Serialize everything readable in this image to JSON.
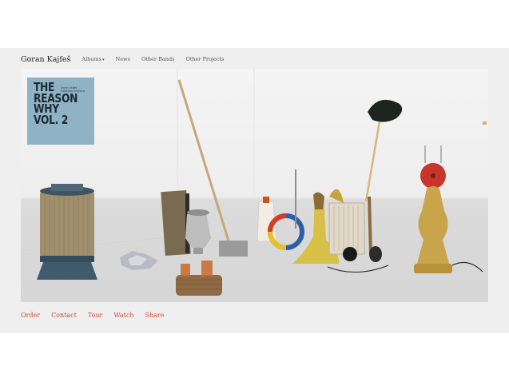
{
  "header": {
    "brand": "Goran Kajfeš",
    "nav": [
      {
        "label": "Albums",
        "dropdown": true
      },
      {
        "label": "News"
      },
      {
        "label": "Other Bands"
      },
      {
        "label": "Other Projects"
      }
    ]
  },
  "cover": {
    "title_lines": "THE\nREASON\nWHY\nVOL. 2",
    "subtitle": "Goran Kajfeš\nSubtropic Arkestra",
    "color": "#8fb3c4"
  },
  "footer": {
    "links": [
      "Order",
      "Contact",
      "Tour",
      "Watch",
      "Share"
    ],
    "link_color": "#d14a3b"
  }
}
